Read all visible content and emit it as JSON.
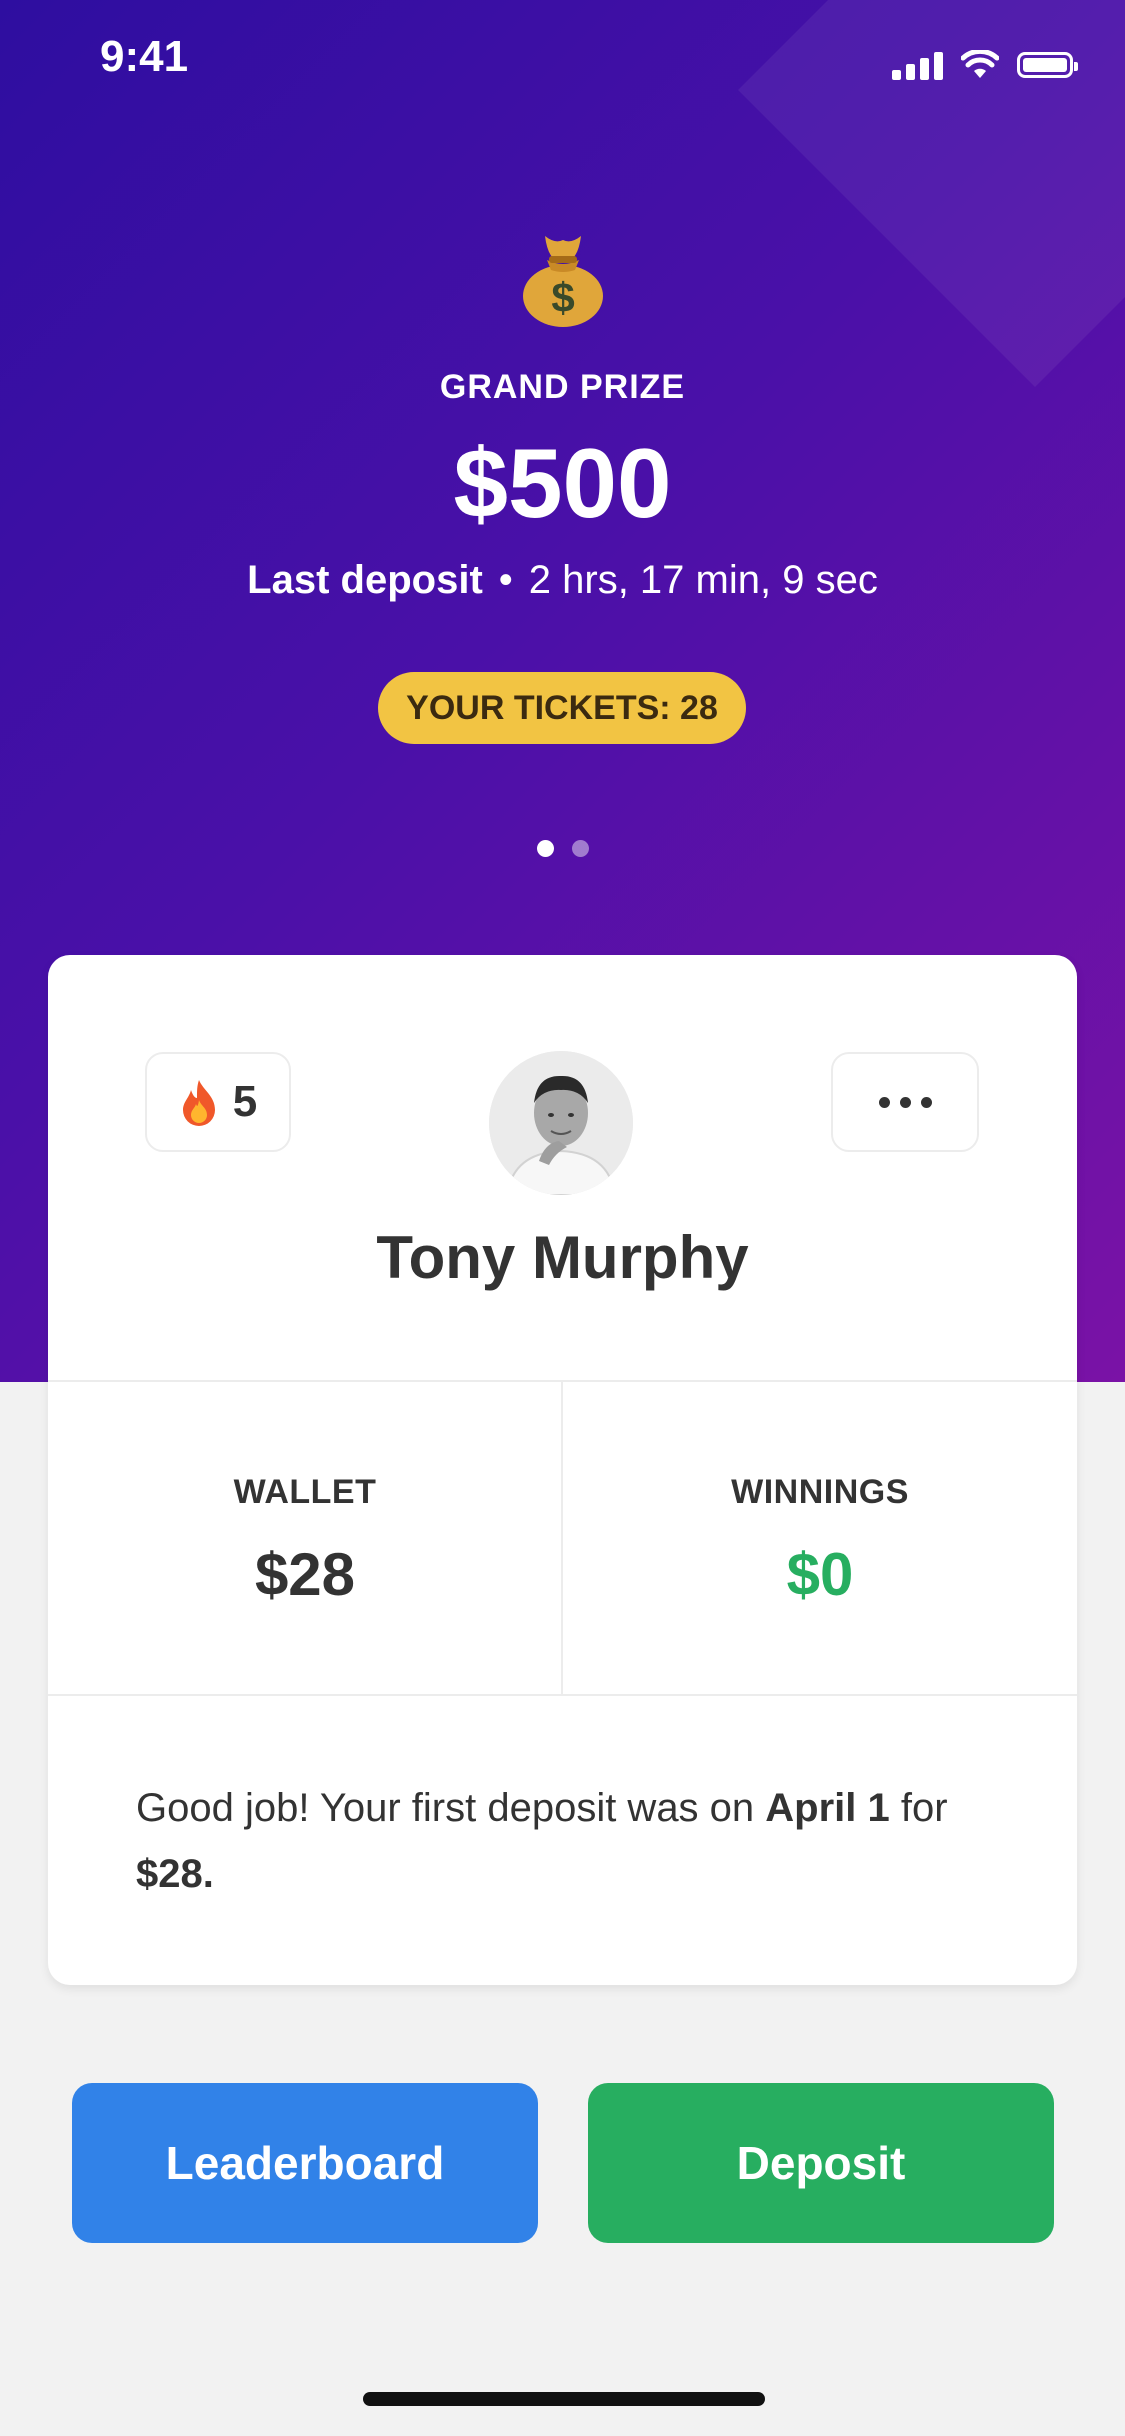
{
  "status_bar": {
    "time": "9:41"
  },
  "hero": {
    "icon": "money-bag-icon",
    "grand_prize_label": "GRAND PRIZE",
    "grand_prize_amount": "$500",
    "last_deposit_label": "Last deposit",
    "separator": "•",
    "last_deposit_time": "2 hrs, 17 min, 9 sec",
    "tickets_label": "YOUR TICKETS: 28",
    "pager": {
      "total": 2,
      "active": 1
    }
  },
  "profile": {
    "streak_icon": "fire-icon",
    "streak_count": "5",
    "more_icon": "ellipsis-icon",
    "name": "Tony Murphy"
  },
  "stats": {
    "wallet_label": "WALLET",
    "wallet_value": "$28",
    "winnings_label": "WINNINGS",
    "winnings_value": "$0"
  },
  "message": {
    "part1": "Good job! Your first deposit was on ",
    "date": "April 1",
    "part2": " for ",
    "amount": "$28."
  },
  "buttons": {
    "leaderboard": "Leaderboard",
    "deposit": "Deposit"
  },
  "colors": {
    "gradient_start": "#2e0ea0",
    "gradient_end": "#7a12a6",
    "ticket_badge": "#f2c443",
    "leaderboard_button": "#3182e8",
    "deposit_button": "#27ae60",
    "winnings_value": "#27ae60",
    "background": "#f2f2f2"
  }
}
